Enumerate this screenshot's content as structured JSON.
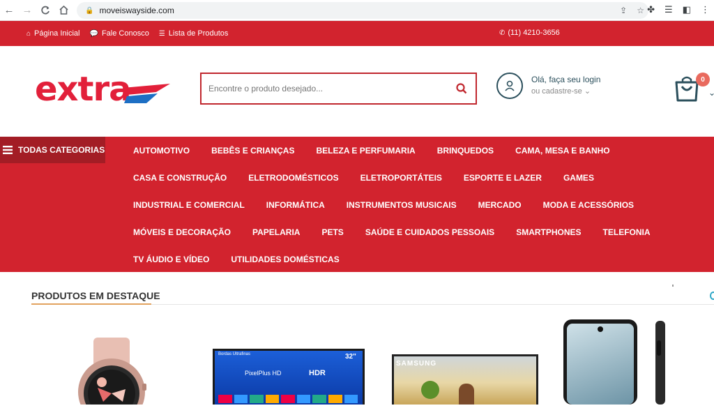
{
  "browser": {
    "url": "moveiswayside.com"
  },
  "topbar": {
    "home": "Página Inicial",
    "contact": "Fale Conosco",
    "products": "Lista de Produtos",
    "phone": "(11) 4210-3656"
  },
  "header": {
    "logo": "extra",
    "search_placeholder": "Encontre o produto desejado...",
    "login_title": "Olá, faça seu login",
    "login_sub": "ou cadastre-se",
    "cart_count": "0"
  },
  "nav": {
    "all_categories": "TODAS CATEGORIAS",
    "rows": [
      [
        "AUTOMOTIVO",
        "BEBÊS E CRIANÇAS",
        "BELEZA E PERFUMARIA",
        "BRINQUEDOS",
        "CAMA, MESA E BANHO"
      ],
      [
        "CASA E CONSTRUÇÃO",
        "ELETRODOMÉSTICOS",
        "ELETROPORTÁTEIS",
        "ESPORTE E LAZER",
        "GAMES"
      ],
      [
        "INDUSTRIAL E COMERCIAL",
        "INFORMÁTICA",
        "INSTRUMENTOS MUSICAIS",
        "MERCADO",
        "MODA E ACESSÓRIOS"
      ],
      [
        "MÓVEIS E DECORAÇÃO",
        "PAPELARIA",
        "PETS",
        "SAÚDE E CUIDADOS PESSOAIS",
        "SMARTPHONES",
        "TELEFONIA"
      ],
      [
        "TV ÁUDIO E VÍDEO",
        "UTILIDADES DOMÉSTICAS"
      ]
    ]
  },
  "featured": {
    "title": "PRODUTOS EM DESTAQUE",
    "tv1_top": "Bordas Ultrafinas",
    "tv1_size": "32\"",
    "tv1_brand": "PixelPlus HD",
    "tv1_hdr": "HDR",
    "tv2_brand": "SAMSUNG"
  },
  "colors": {
    "brand_red": "#d2232e",
    "dark_red": "#a31d25",
    "accent_orange": "#e2a25e"
  }
}
